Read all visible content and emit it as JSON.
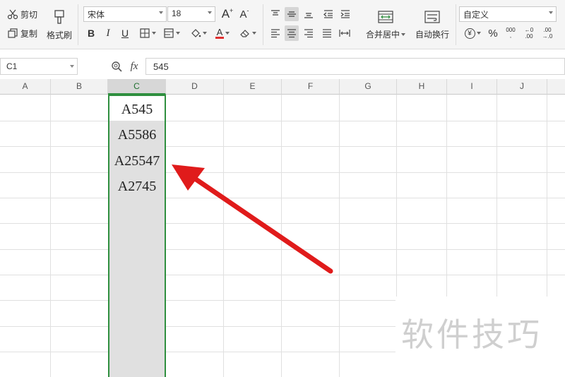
{
  "ribbon": {
    "cut_label": "剪切",
    "copy_label": "复制",
    "format_painter_label": "格式刷",
    "font_name": "宋体",
    "font_size": "18",
    "merge_center_label": "合并居中",
    "wrap_text_label": "自动换行",
    "number_format": "自定义",
    "bold_glyph": "B",
    "italic_glyph": "I",
    "underline_glyph": "U",
    "grow_font_glyph": "A",
    "shrink_font_glyph": "A",
    "font_color_glyph": "A",
    "currency_glyph": "¥",
    "percent_glyph": "%",
    "thousands_glyph": "000",
    "dec_increase_glyph": "←0",
    "dec_increase_glyph2": ".00",
    "dec_decrease_glyph": ".00",
    "dec_decrease_glyph2": "→.0"
  },
  "colors": {
    "selection": "#2f8f3f",
    "font_color": "#e03030"
  },
  "formula_bar": {
    "name_box": "C1",
    "fx_label": "fx",
    "value": "545"
  },
  "columns": [
    "A",
    "B",
    "C",
    "D",
    "E",
    "F",
    "G",
    "H",
    "I",
    "J"
  ],
  "cells": [
    "A545",
    "A5586",
    "A25547",
    "A2745"
  ],
  "watermark": "软件技巧"
}
